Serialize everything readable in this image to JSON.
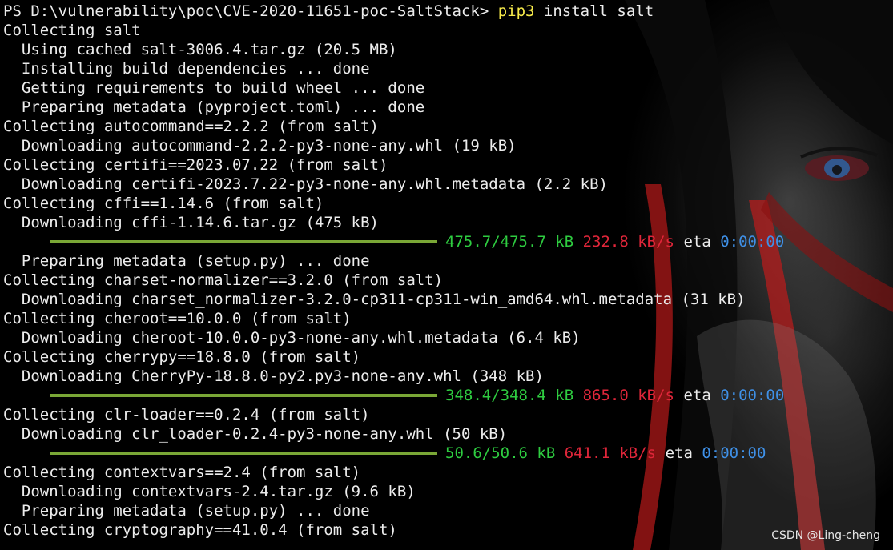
{
  "prompt": {
    "ps": "PS D:\\vulnerability\\poc\\CVE-2020-11651-poc-SaltStack> ",
    "cmd": "pip3",
    "args": " install salt"
  },
  "lines": [
    "Collecting salt",
    "  Using cached salt-3006.4.tar.gz (20.5 MB)",
    "  Installing build dependencies ... done",
    "  Getting requirements to build wheel ... done",
    "  Preparing metadata (pyproject.toml) ... done",
    "Collecting autocommand==2.2.2 (from salt)",
    "  Downloading autocommand-2.2.2-py3-none-any.whl (19 kB)",
    "Collecting certifi==2023.07.22 (from salt)",
    "  Downloading certifi-2023.7.22-py3-none-any.whl.metadata (2.2 kB)",
    "Collecting cffi==1.14.6 (from salt)",
    "  Downloading cffi-1.14.6.tar.gz (475 kB)",
    "  Preparing metadata (setup.py) ... done",
    "Collecting charset-normalizer==3.2.0 (from salt)",
    "  Downloading charset_normalizer-3.2.0-cp311-cp311-win_amd64.whl.metadata (31 kB)",
    "Collecting cheroot==10.0.0 (from salt)",
    "  Downloading cheroot-10.0.0-py3-none-any.whl.metadata (6.4 kB)",
    "Collecting cherrypy==18.8.0 (from salt)",
    "  Downloading CherryPy-18.8.0-py2.py3-none-any.whl (348 kB)",
    "Collecting clr-loader==0.2.4 (from salt)",
    "  Downloading clr_loader-0.2.4-py3-none-any.whl (50 kB)",
    "Collecting contextvars==2.4 (from salt)",
    "  Downloading contextvars-2.4.tar.gz (9.6 kB)",
    "  Preparing metadata (setup.py) ... done",
    "Collecting cryptography==41.0.4 (from salt)"
  ],
  "progress": [
    {
      "amount": "475.7/475.7 kB",
      "speed": "232.8 kB/s",
      "eta_label": "eta",
      "eta": "0:00:00",
      "complete": 1.0
    },
    {
      "amount": "348.4/348.4 kB",
      "speed": "865.0 kB/s",
      "eta_label": "eta",
      "eta": "0:00:00",
      "complete": 1.0
    },
    {
      "amount": "50.6/50.6 kB",
      "speed": "641.1 kB/s",
      "eta_label": "eta",
      "eta": "0:00:00",
      "complete": 1.0
    }
  ],
  "watermark": "CSDN @Ling-cheng",
  "colors": {
    "background": "#000000",
    "text": "#ececec",
    "command": "#f5e94a",
    "progress_bar": "#7aa736",
    "amount": "#2ecc40",
    "speed": "#e0263a",
    "eta": "#3f90e6"
  }
}
